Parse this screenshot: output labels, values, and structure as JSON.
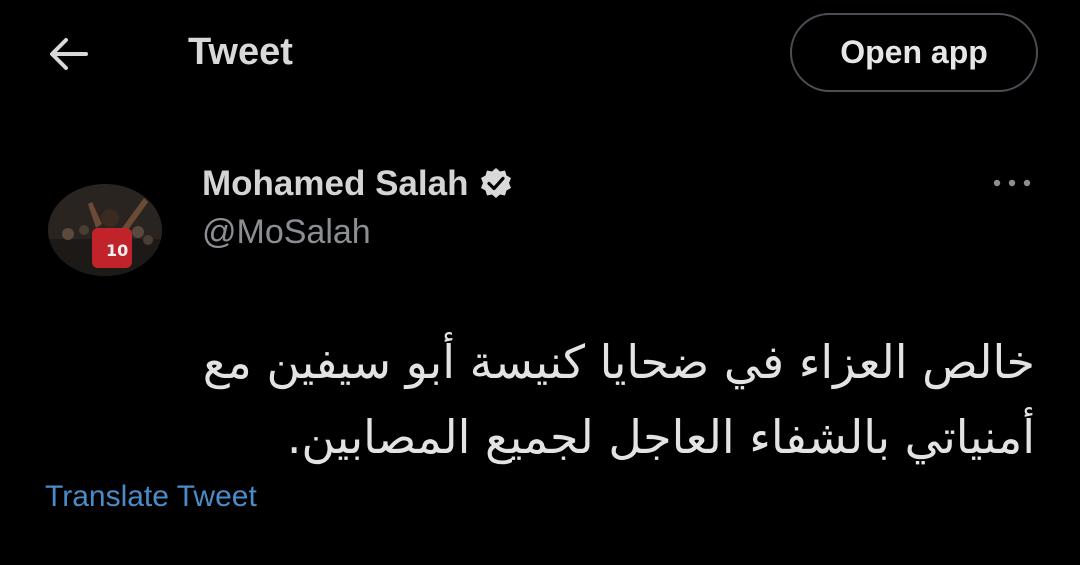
{
  "header": {
    "back_icon": "arrow-left-icon",
    "title": "Tweet",
    "open_app_label": "Open app"
  },
  "tweet": {
    "author_name": "Mohamed Salah",
    "verified_icon": "verified-badge-icon",
    "handle": "@MoSalah",
    "more_icon": "more-horizontal-icon",
    "text": "خالص العزاء في ضحايا كنيسة أبو سيفين مع\nأمنياتي بالشفاء العاجل لجميع المصابين.",
    "translate_label": "Translate Tweet"
  },
  "colors": {
    "background": "#000000",
    "link": "#4a8bc8",
    "secondary_text": "#8b8f94",
    "button_border": "#4a4f55"
  }
}
